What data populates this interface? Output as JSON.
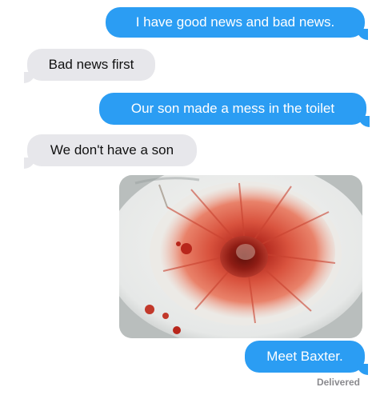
{
  "messages": [
    {
      "from": "me",
      "text": "I have good news and bad news."
    },
    {
      "from": "them",
      "text": "Bad news first"
    },
    {
      "from": "me",
      "text": "Our son made a mess in the toilet"
    },
    {
      "from": "them",
      "text": "We don't have a son"
    },
    {
      "from": "me",
      "type": "image",
      "content": "photo of toilet bowl"
    },
    {
      "from": "me",
      "text": "Meet Baxter."
    }
  ],
  "status": "Delivered",
  "colors": {
    "sent_bubble": "#2b9df3",
    "received_bubble": "#e7e7eb"
  }
}
